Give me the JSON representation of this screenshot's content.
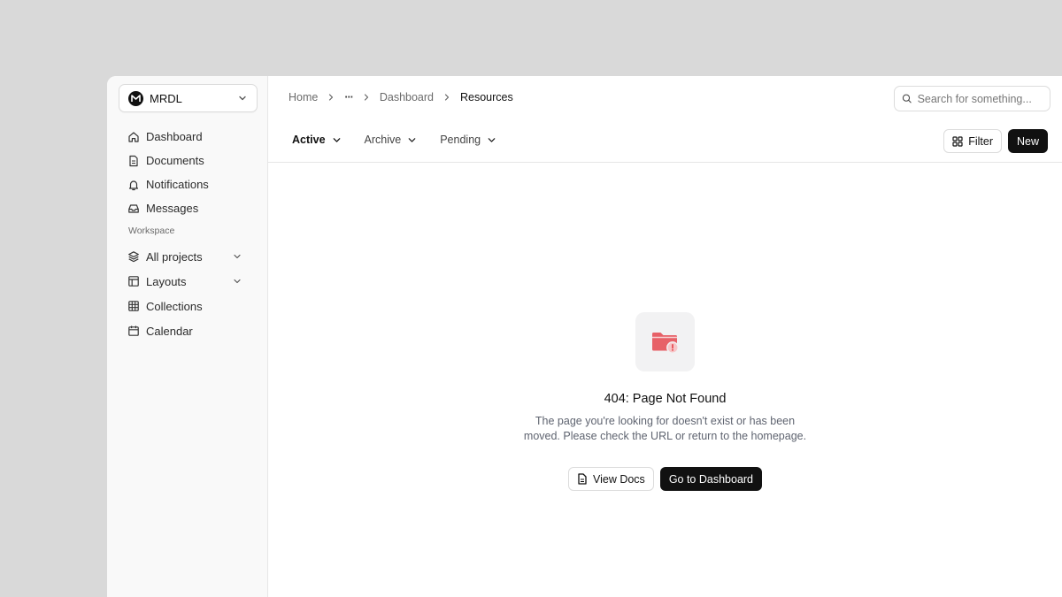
{
  "org": {
    "name": "MRDL"
  },
  "sidebar": {
    "items": [
      {
        "label": "Dashboard",
        "icon": "home-icon"
      },
      {
        "label": "Documents",
        "icon": "document-icon"
      },
      {
        "label": "Notifications",
        "icon": "bell-icon"
      },
      {
        "label": "Messages",
        "icon": "inbox-icon"
      }
    ],
    "workspace_title": "Workspace",
    "workspace_items": [
      {
        "label": "All projects",
        "icon": "layers-icon",
        "expandable": true
      },
      {
        "label": "Layouts",
        "icon": "layout-icon",
        "expandable": true
      },
      {
        "label": "Collections",
        "icon": "grid-icon",
        "expandable": false
      },
      {
        "label": "Calendar",
        "icon": "calendar-icon",
        "expandable": false
      }
    ]
  },
  "breadcrumb": {
    "home": "Home",
    "ellipsis": "···",
    "dashboard": "Dashboard",
    "current": "Resources"
  },
  "search": {
    "placeholder": "Search for something..."
  },
  "tabs": [
    {
      "label": "Active",
      "active": true
    },
    {
      "label": "Archive",
      "active": false
    },
    {
      "label": "Pending",
      "active": false
    }
  ],
  "toolbar": {
    "filter_label": "Filter",
    "new_label": "New"
  },
  "empty_state": {
    "title": "404: Page Not Found",
    "description": "The page you're looking for doesn't exist or has been moved. Please check the URL or return to the homepage.",
    "docs_label": "View Docs",
    "primary_label": "Go to Dashboard",
    "icon": "folder-alert-icon",
    "icon_color": "#e5484d"
  }
}
